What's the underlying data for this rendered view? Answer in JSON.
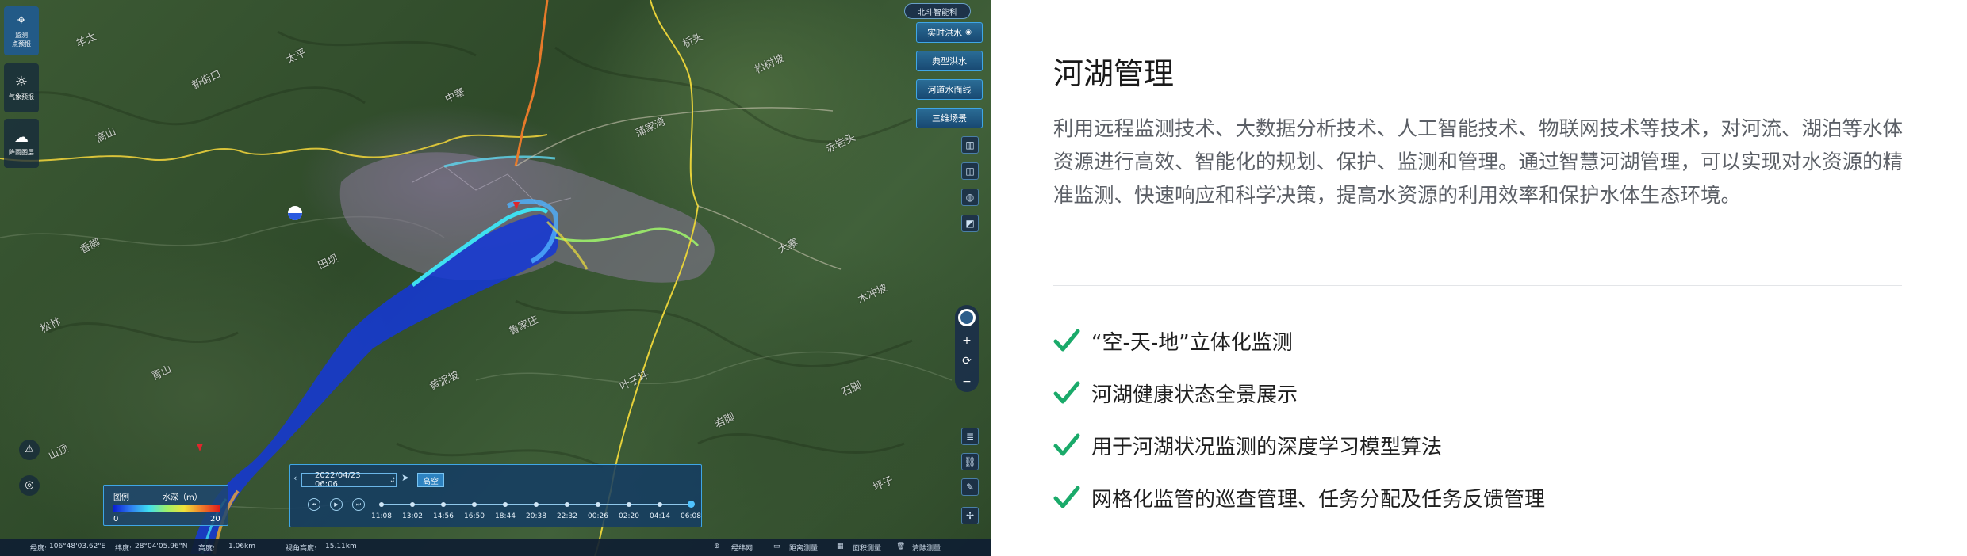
{
  "map": {
    "top_badge": "北斗智能科",
    "left_tools": [
      {
        "label": "监测\n点预报",
        "icon": "sensor-icon"
      },
      {
        "label": "气象预报",
        "icon": "weather-icon"
      },
      {
        "label": "降雨图层",
        "icon": "cloud-rain-icon"
      }
    ],
    "layer_buttons": [
      "实时洪水",
      "典型洪水",
      "河道水面线",
      "三维场景"
    ],
    "place_labels": [
      "羊太",
      "新街口",
      "高山",
      "太平",
      "蒲家湾",
      "松树坡",
      "赤岩头",
      "大寨",
      "木冲坡",
      "香脚",
      "松林",
      "青山",
      "黄泥坡",
      "鲁家庄",
      "叶子坪",
      "岩脚",
      "石脚",
      "山顶",
      "田坝",
      "中寨",
      "桥头",
      "坪子"
    ],
    "legend": {
      "title": "图例",
      "unit": "水深（m）",
      "min": "0",
      "max": "20"
    },
    "timeline": {
      "date": "2022/04/23 06:06",
      "mode": "高空",
      "ticks": [
        "11:08",
        "13:02",
        "14:56",
        "16:50",
        "18:44",
        "20:38",
        "22:32",
        "00:26",
        "02:20",
        "04:14",
        "06:08"
      ]
    },
    "statusbar": {
      "lon_label": "经度:",
      "lon": "106°48'03.62\"E",
      "lat_label": "纬度:",
      "lat": "28°04'05.96\"N",
      "height_label": "高度:",
      "height": "1.06km",
      "view_label": "视角高度:",
      "view_height": "15.11km",
      "tools": [
        "经纬网",
        "距离测量",
        "面积测量",
        "清除测量"
      ]
    },
    "colors": {
      "river_deep": "#0a1fd4",
      "river_mid": "#3fe0f0",
      "border": "#e6d13a",
      "road": "#e67a2a"
    }
  },
  "panel": {
    "title": "河湖管理",
    "description": "利用远程监测技术、大数据分析技术、人工智能技术、物联网技术等技术，对河流、湖泊等水体资源进行高效、智能化的规划、保护、监测和管理。通过智慧河湖管理，可以实现对水资源的精准监测、快速响应和科学决策，提高水资源的利用效率和保护水体生态环境。",
    "features": [
      "“空-天-地”立体化监测",
      "河湖健康状态全景展示",
      "用于河湖状况监测的深度学习模型算法",
      "网格化监管的巡查管理、任务分配及任务反馈管理"
    ],
    "check_color": "#1aaa6a"
  }
}
